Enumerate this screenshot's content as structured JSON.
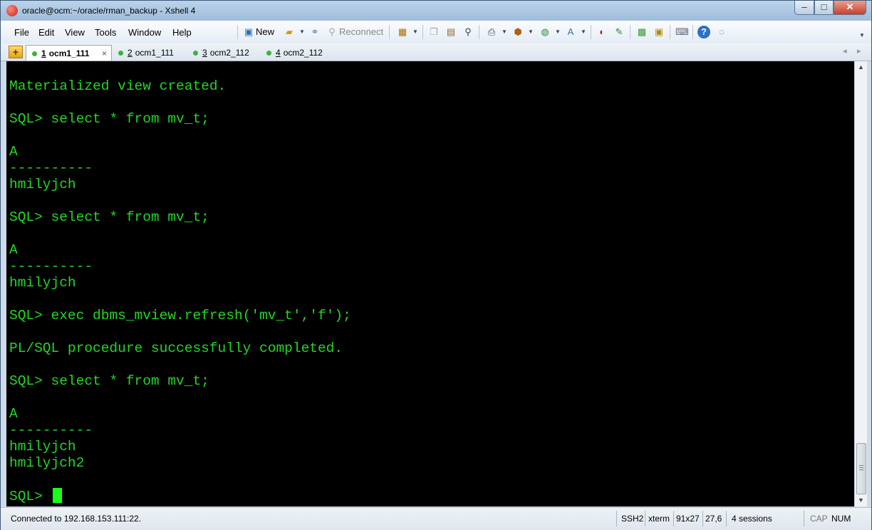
{
  "window": {
    "title": "oracle@ocm:~/oracle/rman_backup - Xshell 4",
    "controls": {
      "minimize": "–",
      "maximize": "□",
      "close": "✕"
    }
  },
  "menu": {
    "items": [
      "File",
      "Edit",
      "View",
      "Tools",
      "Window",
      "Help"
    ]
  },
  "toolbar": {
    "new_label": "New",
    "reconnect_label": "Reconnect"
  },
  "tabs": [
    {
      "number": "1",
      "name": "ocm1_111",
      "active": true,
      "close": "×"
    },
    {
      "number": "2",
      "name": "ocm1_111",
      "active": false
    },
    {
      "number": "3",
      "name": "ocm2_112",
      "active": false
    },
    {
      "number": "4",
      "name": "ocm2_112",
      "active": false
    }
  ],
  "terminal": {
    "text_color": "#23d723",
    "background": "#000000",
    "lines": [
      "Materialized view created.",
      "",
      "SQL> select * from mv_t;",
      "",
      "A",
      "----------",
      "hmilyjch",
      "",
      "SQL> select * from mv_t;",
      "",
      "A",
      "----------",
      "hmilyjch",
      "",
      "SQL> exec dbms_mview.refresh('mv_t','f');",
      "",
      "PL/SQL procedure successfully completed.",
      "",
      "SQL> select * from mv_t;",
      "",
      "A",
      "----------",
      "hmilyjch",
      "hmilyjch2",
      ""
    ],
    "prompt": "SQL> "
  },
  "status": {
    "connection": "Connected to 192.168.153.111:22.",
    "protocol": "SSH2",
    "terminal_type": "xterm",
    "size": "91x27",
    "cursor_pos": "27,6",
    "sessions": "4 sessions",
    "caps": "CAP",
    "num": "NUM"
  }
}
